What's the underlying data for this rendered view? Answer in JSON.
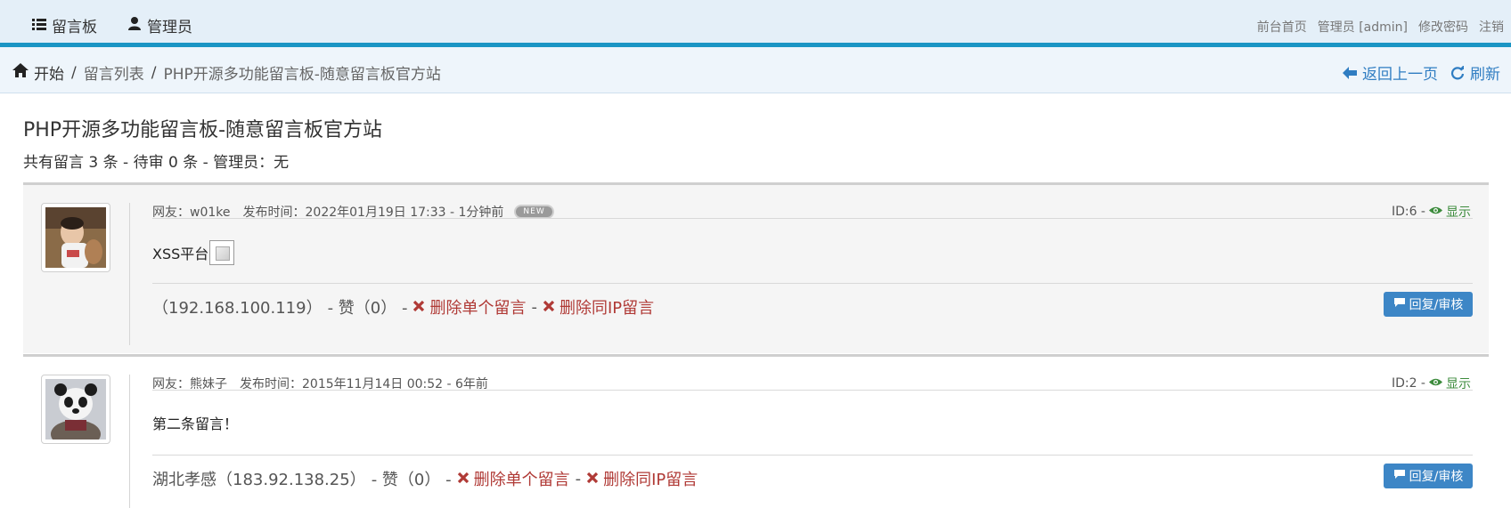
{
  "navbar": {
    "left": [
      {
        "label": "留言板",
        "icon": "list-icon"
      },
      {
        "label": "管理员",
        "icon": "user-icon"
      }
    ],
    "right": [
      "前台首页",
      "管理员 [admin]",
      "修改密码",
      "注销"
    ]
  },
  "breadcrumb": {
    "home": "开始",
    "sep": "/",
    "list": "留言列表",
    "current": "PHP开源多功能留言板-随意留言板官方站",
    "back": "返回上一页",
    "refresh": "刷新"
  },
  "page": {
    "title": "PHP开源多功能留言板-随意留言板官方站",
    "summary": "共有留言 3 条 - 待审 0 条 - 管理员：无"
  },
  "messages": [
    {
      "author": "网友：w01ke",
      "time": "发布时间：2022年01月19日 17:33 - 1分钟前",
      "badge": "NEW",
      "id": "ID:6 -",
      "status": "显示",
      "content": "XSS平台",
      "ip": "（192.168.100.119）",
      "like": "- 赞（0） -",
      "del_one": "删除单个留言",
      "dash": "-",
      "del_ip": "删除同IP留言",
      "reply": "回复/审核"
    },
    {
      "author": "网友：熊妹子",
      "time": "发布时间：2015年11月14日 00:52 - 6年前",
      "id": "ID:2 -",
      "status": "显示",
      "content": "第二条留言！",
      "ip": "湖北孝感（183.92.138.25）",
      "like": "- 赞（0） -",
      "del_one": "删除单个留言",
      "dash": "-",
      "del_ip": "删除同IP留言",
      "reply": "回复/审核"
    }
  ],
  "colors": {
    "accent": "#1a95c4",
    "link": "#2f7dc2",
    "danger": "#b03a36",
    "success": "#3c8b3c",
    "button": "#3d86c6"
  }
}
